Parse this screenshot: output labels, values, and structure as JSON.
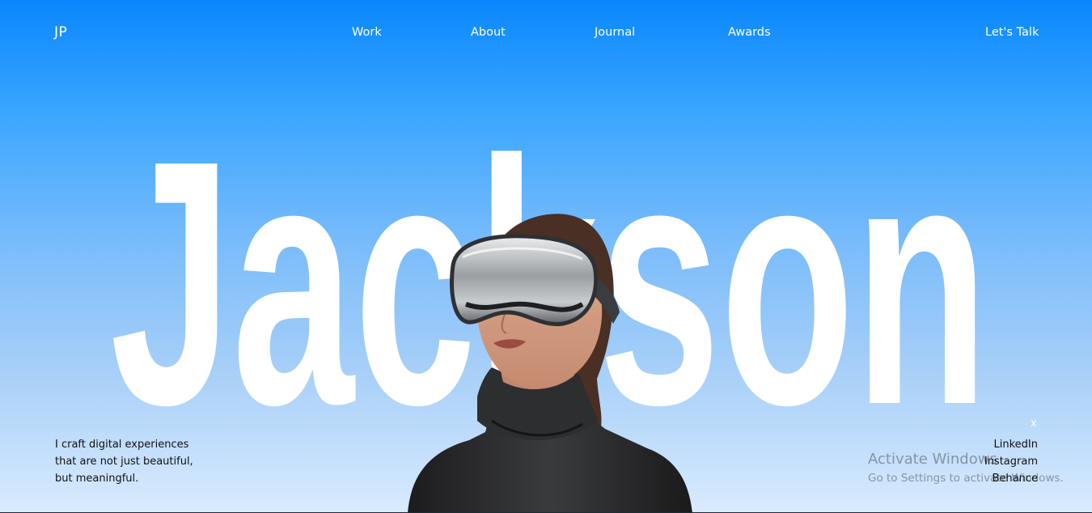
{
  "nav": {
    "logo": "JP",
    "links": [
      "Work",
      "About",
      "Journal",
      "Awards"
    ],
    "cta": "Let's Talk"
  },
  "hero": {
    "name": "Jackson"
  },
  "tagline": {
    "lines": [
      "I craft digital experiences",
      "that are not just beautiful,",
      "but meaningful."
    ]
  },
  "social": {
    "close": "x",
    "links": [
      "LinkedIn",
      "Instagram",
      "Behance"
    ]
  },
  "watermark": {
    "title": "Activate Windows",
    "subtitle": "Go to Settings to activate Windows."
  },
  "colors": {
    "sky_top": "#0a87fd",
    "sky_bottom": "#d9ebfe",
    "hero_text": "#ffffff",
    "body_text": "#111111"
  },
  "icons": {
    "portrait": "person-wearing-vr-headset-photo"
  }
}
